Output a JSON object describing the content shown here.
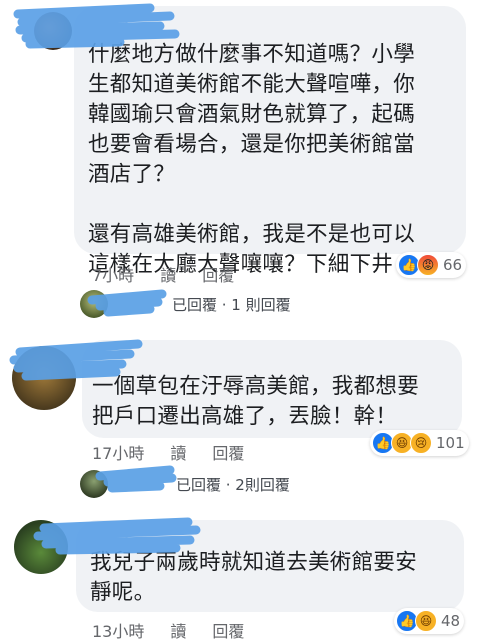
{
  "comments": [
    {
      "paragraphs": [
        [
          "什麼地方做什麼事不知道嗎？小學",
          "生都知道美術館不能大聲喧嘩，你",
          "韓國瑜只會酒氣財色就算了，起碼",
          "也要會看場合，還是你把美術館當",
          "酒店了？"
        ],
        [
          "還有高雄美術館，我是不是也可以",
          "這樣在大廳大聲嚷嚷？下細下井"
        ]
      ],
      "time": "7小時",
      "read_label": "讀",
      "reply_label": "回覆",
      "reactions": [
        "like",
        "angry"
      ],
      "reaction_count": "66",
      "reply_summary": "已回覆 · 1 則回覆"
    },
    {
      "paragraphs": [
        [
          "一個草包在汙辱高美館，我都想要",
          "把戶口遷出高雄了，丟臉！幹！"
        ]
      ],
      "time": "17小時",
      "read_label": "讀",
      "reply_label": "回覆",
      "reactions": [
        "like",
        "haha",
        "sad"
      ],
      "reaction_count": "101",
      "reply_summary": "已回覆 · 2則回覆"
    },
    {
      "paragraphs": [
        [
          "我兒子兩歲時就知道去美術館要安",
          "靜呢。"
        ]
      ],
      "time": "13小時",
      "read_label": "讀",
      "reply_label": "回覆",
      "reactions": [
        "like",
        "haha"
      ],
      "reaction_count": "48"
    }
  ],
  "colors": {
    "bubble": "#f0f2f5",
    "redaction": "#5aa0e6",
    "like": "#1877f2",
    "meta_text": "#65676b"
  }
}
